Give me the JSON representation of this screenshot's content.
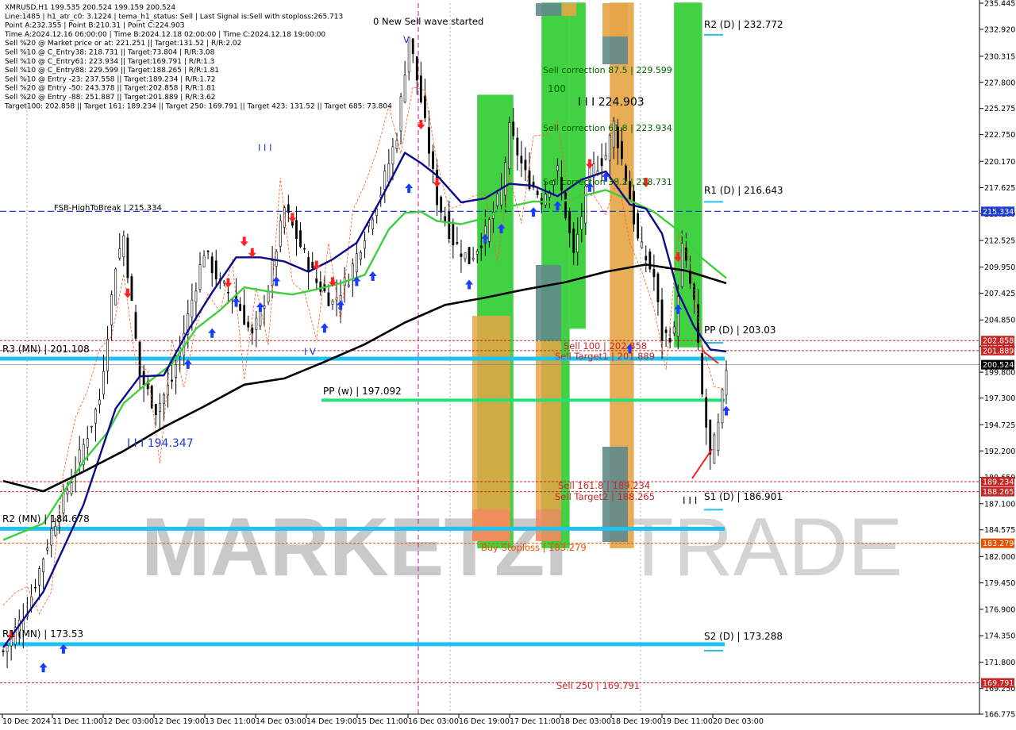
{
  "info_lines": [
    "XMRUSD,H1  199.535 200.524 199.159 200.524",
    "Line:1485 | h1_atr_c0: 3.1224 | tema_h1_status: Sell | Last Signal is:Sell with stoploss:265.713",
    "Point A:232.355 | Point B:210.31 | Point C:224.903",
    "Time A:2024.12.16 06:00:00 | Time B:2024.12.18 02:00:00 | Time C:2024.12.18 19:00:00",
    "Sell %20 @ Market price or at: 221.251 || Target:131.52 | R/R:2.02",
    "Sell %10 @ C_Entry38: 218.731 || Target:73.804 | R/R:3.08",
    "Sell %10 @ C_Entry61: 223.934 || Target:169.791 | R/R:1.3",
    "Sell %10 @ C_Entry88: 229.599 || Target:188.265 | R/R:1.81",
    "Sell %10 @ Entry -23: 237.558 || Target:189.234 | R/R:1.72",
    "Sell %20 @ Entry -50: 243.378 || Target:202.858 | R/R:1.81",
    "Sell %20 @ Entry -88: 251.887 || Target:201.889 | R/R:3.62",
    "Target100: 202.858 || Target 161: 189.234 || Target 250: 169.791 || Target 423: 131.52 || Target 685: 73.804"
  ],
  "watermark": {
    "brand": "MARKETZI",
    "suffix": "TRADE"
  },
  "annotations": {
    "new_wave": "0 New Sell wave started",
    "wave_top": "V",
    "wave_iii_a": "I I I",
    "wave_iii_b": "I I I  194.347",
    "wave_iv": "I V",
    "wave_c": "I I I  224.903",
    "sell_corr_875": "Sell correction 87.5 | 229.599",
    "sell_corr_618": "Sell correction 61.8 | 223.934",
    "sell_corr_382": "Sell correction 38.2 | 218.731",
    "lbl_100": "100",
    "sell_100": "Sell 100 | 202.858",
    "sell_target1": "Sell Target1 | 201.889",
    "sell_1618": "Sell 161.8 | 189.234",
    "sell_target2": "Sell Target2 | 188.265",
    "buy_stoploss": "Buy Stoploss | 183.279",
    "sell_250": "Sell  250 | 169.791",
    "fsb": "FSB-HighToBreak | 215.334",
    "r2d": "R2 (D) | 232.772",
    "r1d": "R1 (D) | 216.643",
    "ppd": "PP (D) | 203.03",
    "s1d": "S1 (D) | 186.901",
    "s2d": "S2 (D) | 173.288",
    "r3mn": "R3 (MN) | 201.108",
    "r2mn": "R2 (MN) | 184.678",
    "r1mn": "R1 (MN) | 173.53",
    "ppw": "PP (w) | 197.092",
    "tick_s1": "I I I"
  },
  "price_tags": [
    {
      "text": "215.334",
      "value": 215.334,
      "bg": "#1e3cd2"
    },
    {
      "text": "202.858",
      "value": 202.858,
      "bg": "#c62828"
    },
    {
      "text": "201.889",
      "value": 201.889,
      "bg": "#c62828"
    },
    {
      "text": "200.524",
      "value": 200.524,
      "bg": "#000000"
    },
    {
      "text": "189.234",
      "value": 189.234,
      "bg": "#c62828"
    },
    {
      "text": "188.265",
      "value": 188.265,
      "bg": "#c62828"
    },
    {
      "text": "183.279",
      "value": 183.279,
      "bg": "#e65100"
    },
    {
      "text": "169.791",
      "value": 169.791,
      "bg": "#c62828"
    }
  ],
  "colors": {
    "ma_black": "#000000",
    "ma_blue": "#0a0a8c",
    "ma_green": "#3ecf3e",
    "pivot_cyan": "#1ec3f0",
    "ppw_green": "#22e07a",
    "sell_red": "#c62828",
    "buy_orange": "#e65100",
    "fsb_blue": "#1e3cd2",
    "arrow_up": "#1a3cff",
    "arrow_down": "#ff2020"
  },
  "chart_data": {
    "type": "candlestick",
    "symbol": "XMRUSD",
    "timeframe": "H1",
    "ylim": [
      166.775,
      235.445
    ],
    "y_ticks": [
      235.445,
      232.92,
      230.315,
      227.8,
      225.275,
      222.75,
      220.17,
      217.625,
      215.1,
      212.525,
      209.95,
      207.425,
      204.85,
      202.325,
      199.8,
      197.3,
      194.725,
      192.2,
      189.65,
      187.1,
      184.575,
      182.0,
      179.45,
      176.9,
      174.35,
      171.8,
      169.25,
      166.775
    ],
    "x_labels": [
      "10 Dec 2024",
      "11 Dec 11:00",
      "12 Dec 03:00",
      "12 Dec 19:00",
      "13 Dec 11:00",
      "14 Dec 03:00",
      "14 Dec 19:00",
      "15 Dec 11:00",
      "16 Dec 03:00",
      "16 Dec 19:00",
      "17 Dec 11:00",
      "18 Dec 03:00",
      "18 Dec 19:00",
      "19 Dec 11:00",
      "20 Dec 03:00"
    ],
    "close_path": [
      [
        0,
        172.8
      ],
      [
        6,
        177.0
      ],
      [
        12,
        184.5
      ],
      [
        18,
        190.5
      ],
      [
        24,
        197.2
      ],
      [
        28,
        210.3
      ],
      [
        30,
        213.0
      ],
      [
        34,
        199.5
      ],
      [
        38,
        196.2
      ],
      [
        42,
        199.0
      ],
      [
        46,
        205.2
      ],
      [
        50,
        211.5
      ],
      [
        54,
        208.3
      ],
      [
        58,
        206.8
      ],
      [
        62,
        203.2
      ],
      [
        66,
        208.0
      ],
      [
        70,
        215.6
      ],
      [
        74,
        212.0
      ],
      [
        78,
        208.5
      ],
      [
        82,
        206.5
      ],
      [
        86,
        209.0
      ],
      [
        90,
        213.2
      ],
      [
        94,
        217.2
      ],
      [
        98,
        222.8
      ],
      [
        101,
        232.3
      ],
      [
        104,
        226.0
      ],
      [
        108,
        216.5
      ],
      [
        112,
        212.5
      ],
      [
        116,
        210.6
      ],
      [
        120,
        213.2
      ],
      [
        124,
        217.3
      ],
      [
        126,
        223.2
      ],
      [
        130,
        218.8
      ],
      [
        134,
        216.6
      ],
      [
        138,
        219.2
      ],
      [
        142,
        211.0
      ],
      [
        146,
        219.0
      ],
      [
        150,
        220.8
      ],
      [
        152,
        223.8
      ],
      [
        155,
        218.6
      ],
      [
        158,
        212.5
      ],
      [
        162,
        209.0
      ],
      [
        164,
        203.2
      ],
      [
        167,
        203.6
      ],
      [
        169,
        211.8
      ],
      [
        172,
        206.5
      ],
      [
        174,
        197.5
      ],
      [
        176,
        191.5
      ],
      [
        178,
        194.5
      ],
      [
        180,
        200.3
      ]
    ],
    "ma_black": [
      [
        0,
        189.3
      ],
      [
        10,
        188.3
      ],
      [
        20,
        190.2
      ],
      [
        30,
        192.2
      ],
      [
        40,
        194.5
      ],
      [
        50,
        196.5
      ],
      [
        60,
        198.6
      ],
      [
        70,
        199.2
      ],
      [
        80,
        200.8
      ],
      [
        90,
        202.5
      ],
      [
        100,
        204.6
      ],
      [
        110,
        206.3
      ],
      [
        120,
        207.0
      ],
      [
        130,
        207.8
      ],
      [
        140,
        208.5
      ],
      [
        150,
        209.5
      ],
      [
        160,
        210.2
      ],
      [
        170,
        209.6
      ],
      [
        180,
        208.4
      ]
    ],
    "ma_blue": [
      [
        0,
        173.2
      ],
      [
        10,
        178.6
      ],
      [
        20,
        187.0
      ],
      [
        28,
        196.3
      ],
      [
        34,
        199.4
      ],
      [
        40,
        199.5
      ],
      [
        46,
        203.8
      ],
      [
        52,
        207.5
      ],
      [
        58,
        210.9
      ],
      [
        64,
        210.9
      ],
      [
        70,
        210.5
      ],
      [
        76,
        209.5
      ],
      [
        82,
        210.7
      ],
      [
        88,
        212.3
      ],
      [
        94,
        216.5
      ],
      [
        100,
        221.0
      ],
      [
        104,
        220.0
      ],
      [
        108,
        218.8
      ],
      [
        114,
        216.2
      ],
      [
        120,
        216.6
      ],
      [
        126,
        218.0
      ],
      [
        132,
        217.8
      ],
      [
        138,
        216.8
      ],
      [
        144,
        218.4
      ],
      [
        150,
        219.2
      ],
      [
        156,
        216.0
      ],
      [
        160,
        215.6
      ],
      [
        164,
        213.2
      ],
      [
        168,
        207.5
      ],
      [
        172,
        204.2
      ],
      [
        176,
        202.0
      ],
      [
        180,
        201.8
      ]
    ],
    "ma_green": [
      [
        0,
        183.6
      ],
      [
        10,
        185.2
      ],
      [
        20,
        191.2
      ],
      [
        26,
        194.0
      ],
      [
        30,
        196.8
      ],
      [
        36,
        198.8
      ],
      [
        42,
        200.6
      ],
      [
        48,
        204.0
      ],
      [
        54,
        205.8
      ],
      [
        60,
        208.0
      ],
      [
        66,
        207.6
      ],
      [
        72,
        207.3
      ],
      [
        78,
        207.8
      ],
      [
        84,
        208.4
      ],
      [
        90,
        209.2
      ],
      [
        96,
        213.6
      ],
      [
        100,
        215.2
      ],
      [
        104,
        215.3
      ],
      [
        108,
        214.4
      ],
      [
        114,
        214.1
      ],
      [
        120,
        214.7
      ],
      [
        126,
        215.8
      ],
      [
        132,
        216.3
      ],
      [
        138,
        216.2
      ],
      [
        144,
        216.8
      ],
      [
        150,
        217.4
      ],
      [
        156,
        216.4
      ],
      [
        162,
        215.3
      ],
      [
        168,
        213.5
      ],
      [
        174,
        210.8
      ],
      [
        180,
        208.9
      ]
    ],
    "bands": [
      {
        "x0": 118,
        "x1": 127,
        "y0": 226.6,
        "y1": 182.8,
        "fill": "#2ecc2e"
      },
      {
        "x0": 134,
        "x1": 141,
        "y0": 235.5,
        "y1": 182.8,
        "fill": "#2ecc2e"
      },
      {
        "x0": 141,
        "x1": 145,
        "y0": 235.5,
        "y1": 204.0,
        "fill": "#2ecc2e"
      },
      {
        "x0": 151,
        "x1": 157,
        "y0": 235.5,
        "y1": 182.8,
        "fill": "#e6a445"
      },
      {
        "x0": 167,
        "x1": 174,
        "y0": 235.5,
        "y1": 202.2,
        "fill": "#2ecc2e"
      }
    ]
  }
}
